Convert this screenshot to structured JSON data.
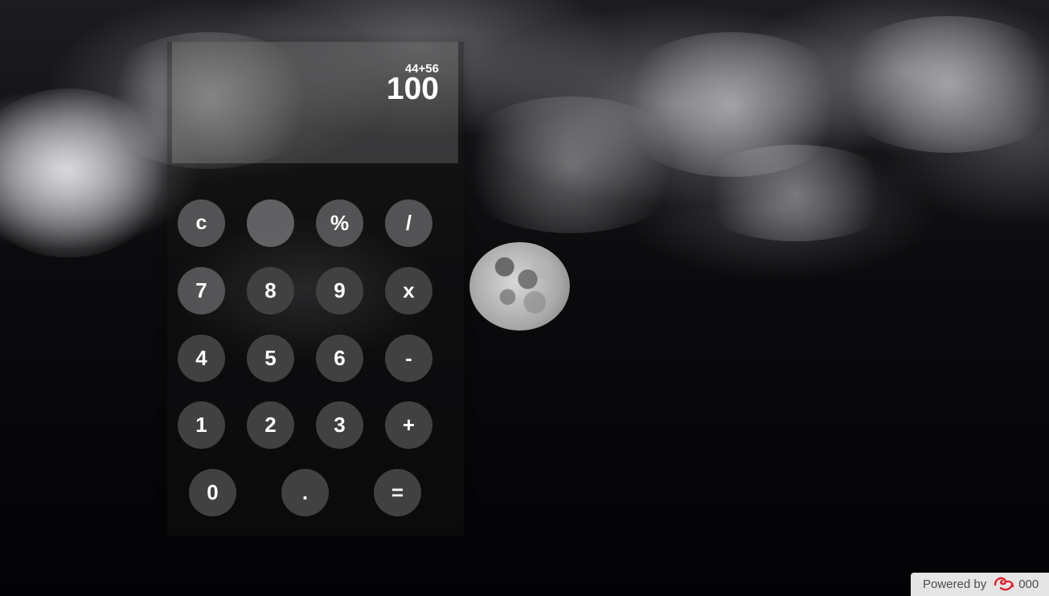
{
  "calculator": {
    "expression": "44+56",
    "result": "100",
    "keys": {
      "clear": "c",
      "blank": "",
      "percent": "%",
      "divide": "/",
      "seven": "7",
      "eight": "8",
      "nine": "9",
      "multiply": "x",
      "four": "4",
      "five": "5",
      "six": "6",
      "minus": "-",
      "one": "1",
      "two": "2",
      "three": "3",
      "plus": "+",
      "zero": "0",
      "decimal": ".",
      "equals": "="
    }
  },
  "footer": {
    "powered_label": "Powered by",
    "brand_label": "000"
  },
  "icons": {
    "brand_logo": "000webhost-logo-icon"
  },
  "colors": {
    "button_dark": "#414141",
    "button_light": "#6e6e70",
    "text": "#ffffff",
    "brand_red": "#e2222b"
  }
}
